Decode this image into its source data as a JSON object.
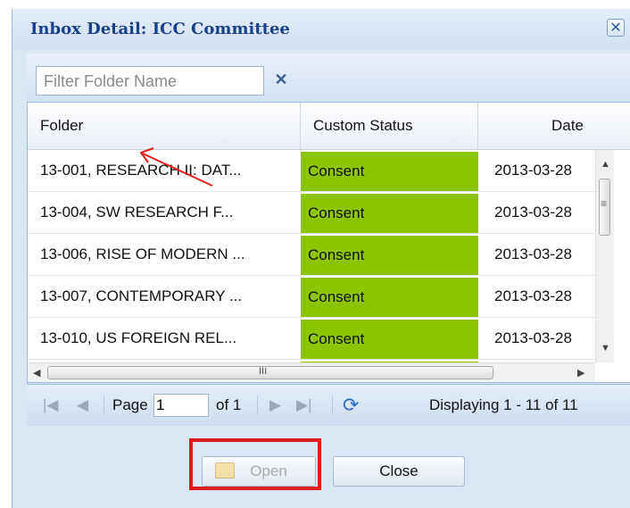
{
  "dialog": {
    "title": "Inbox Detail: ICC Committee",
    "close_glyph": "✕"
  },
  "filter": {
    "placeholder": "Filter Folder Name",
    "clear_glyph": "✕"
  },
  "grid": {
    "columns": [
      "Folder",
      "Custom Status",
      "Date"
    ],
    "rows": [
      {
        "folder": "13-001, RESEARCH II: DAT...",
        "status": "Consent",
        "date": "2013-03-28"
      },
      {
        "folder": "13-004, SW RESEARCH F...",
        "status": "Consent",
        "date": "2013-03-28"
      },
      {
        "folder": "13-006, RISE OF MODERN ...",
        "status": "Consent",
        "date": "2013-03-28"
      },
      {
        "folder": "13-007, CONTEMPORARY ...",
        "status": "Consent",
        "date": "2013-03-28"
      },
      {
        "folder": "13-010, US FOREIGN REL...",
        "status": "Consent",
        "date": "2013-03-28"
      }
    ],
    "status_color": "#8cc400",
    "scroll_up": "▲",
    "scroll_down": "▼",
    "scroll_left": "◀",
    "scroll_right": "▶",
    "thumb_grip_v": "≡",
    "thumb_grip_h": "III"
  },
  "paging": {
    "first_icon": "first-page-icon",
    "prev_icon": "prev-page-icon",
    "page_label": "Page",
    "page_value": "1",
    "of_label": "of 1",
    "next_icon": "next-page-icon",
    "last_icon": "last-page-icon",
    "refresh_icon": "refresh-icon",
    "display_text": "Displaying 1 - 11 of 11"
  },
  "buttons": {
    "open_label": "Open",
    "close_label": "Close"
  },
  "annotation_color": "#e21b1b"
}
